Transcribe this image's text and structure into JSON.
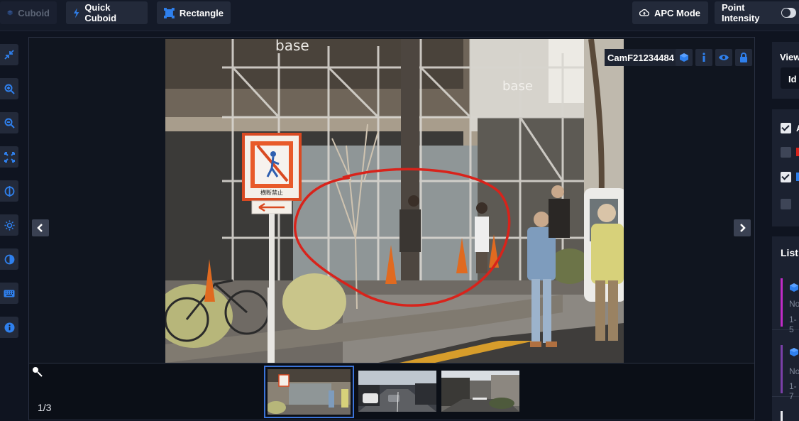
{
  "toolbar": {
    "cuboid_label": "Cuboid",
    "quick_cuboid_label": "Quick Cuboid",
    "rectangle_label": "Rectangle",
    "apc_mode_label": "APC Mode",
    "point_intensity_label": "Point Intensity",
    "point_intensity_on": false
  },
  "left_tools": [
    {
      "icon": "collapse-icon"
    },
    {
      "icon": "zoom-in-icon"
    },
    {
      "icon": "zoom-out-icon"
    },
    {
      "icon": "fit-screen-icon"
    },
    {
      "icon": "contrast-split-icon"
    },
    {
      "icon": "brightness-icon"
    },
    {
      "icon": "contrast-icon"
    },
    {
      "icon": "keyboard-icon"
    },
    {
      "icon": "info-icon"
    }
  ],
  "viewer": {
    "camera_label": "CamF21234484",
    "counter": "1/3",
    "sign_text": "横断禁止",
    "store_sign": "base",
    "store_sign_2": "base",
    "thumbnails": 3,
    "active_thumbnail": 1
  },
  "right_panel": {
    "view_label": "View",
    "view_select": "Id",
    "checkbox_a_label": "A",
    "checkboxes": [
      true,
      false,
      true,
      false
    ],
    "list_title": "List",
    "list_items": [
      {
        "color": "#c02bc7",
        "line1": "No",
        "line2": "1-5"
      },
      {
        "color": "#7a3fa8",
        "line1": "No",
        "line2": "1-7"
      }
    ]
  },
  "colors": {
    "accent": "#2f80ed",
    "annotation_circle": "#d8231b"
  }
}
